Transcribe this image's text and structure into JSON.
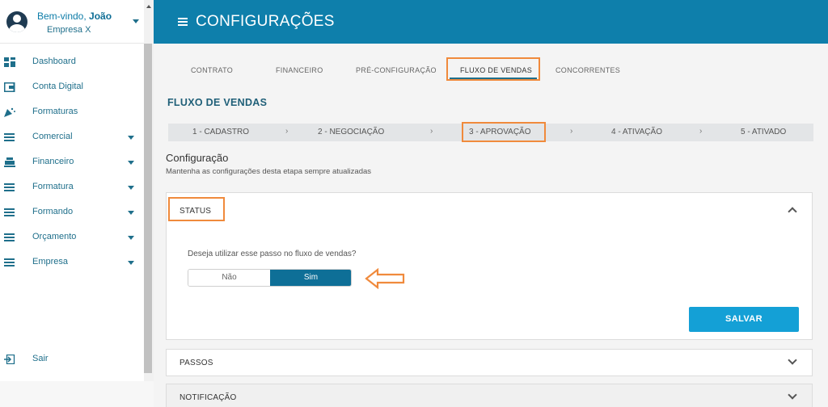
{
  "user": {
    "greeting": "Bem-vindo,",
    "name": "João",
    "company": "Empresa X"
  },
  "sidebar": {
    "items": [
      {
        "label": "Dashboard",
        "icon": "dashboard-icon",
        "has_caret": false
      },
      {
        "label": "Conta Digital",
        "icon": "wallet-icon",
        "has_caret": false
      },
      {
        "label": "Formaturas",
        "icon": "party-icon",
        "has_caret": false
      },
      {
        "label": "Comercial",
        "icon": "menu-icon",
        "has_caret": true
      },
      {
        "label": "Financeiro",
        "icon": "register-icon",
        "has_caret": true
      },
      {
        "label": "Formatura",
        "icon": "menu-icon",
        "has_caret": true
      },
      {
        "label": "Formando",
        "icon": "menu-icon",
        "has_caret": true
      },
      {
        "label": "Orçamento",
        "icon": "menu-icon",
        "has_caret": true
      },
      {
        "label": "Empresa",
        "icon": "menu-icon",
        "has_caret": true
      }
    ],
    "logout_label": "Sair"
  },
  "header": {
    "title": "CONFIGURAÇÕES"
  },
  "tabs": [
    {
      "label": "CONTRATO",
      "active": false
    },
    {
      "label": "FINANCEIRO",
      "active": false
    },
    {
      "label": "PRÉ-CONFIGURAÇÃO",
      "active": false
    },
    {
      "label": "FLUXO DE VENDAS",
      "active": true
    },
    {
      "label": "CONCORRENTES",
      "active": false
    }
  ],
  "section_title": "FLUXO DE VENDAS",
  "steps": [
    {
      "label": "1 - CADASTRO"
    },
    {
      "label": "2 - NEGOCIAÇÃO"
    },
    {
      "label": "3 - APROVAÇÃO"
    },
    {
      "label": "4 - ATIVAÇÃO"
    },
    {
      "label": "5 - ATIVADO"
    }
  ],
  "step_separator": "›",
  "config": {
    "title": "Configuração",
    "subtitle": "Mantenha as configurações desta etapa sempre atualizadas"
  },
  "status_panel": {
    "label": "STATUS",
    "question": "Deseja utilizar esse passo no fluxo de vendas?",
    "option_no": "Não",
    "option_yes": "Sim",
    "selected": "Sim",
    "save_label": "SALVAR"
  },
  "passos_panel": {
    "label": "PASSOS"
  },
  "notificacao_panel": {
    "label": "NOTIFICAÇÃO"
  },
  "colors": {
    "header_bg": "#0e7fab",
    "accent_dark": "#0e6f97",
    "save_button": "#14a0d6",
    "highlight": "#f08a3c"
  }
}
